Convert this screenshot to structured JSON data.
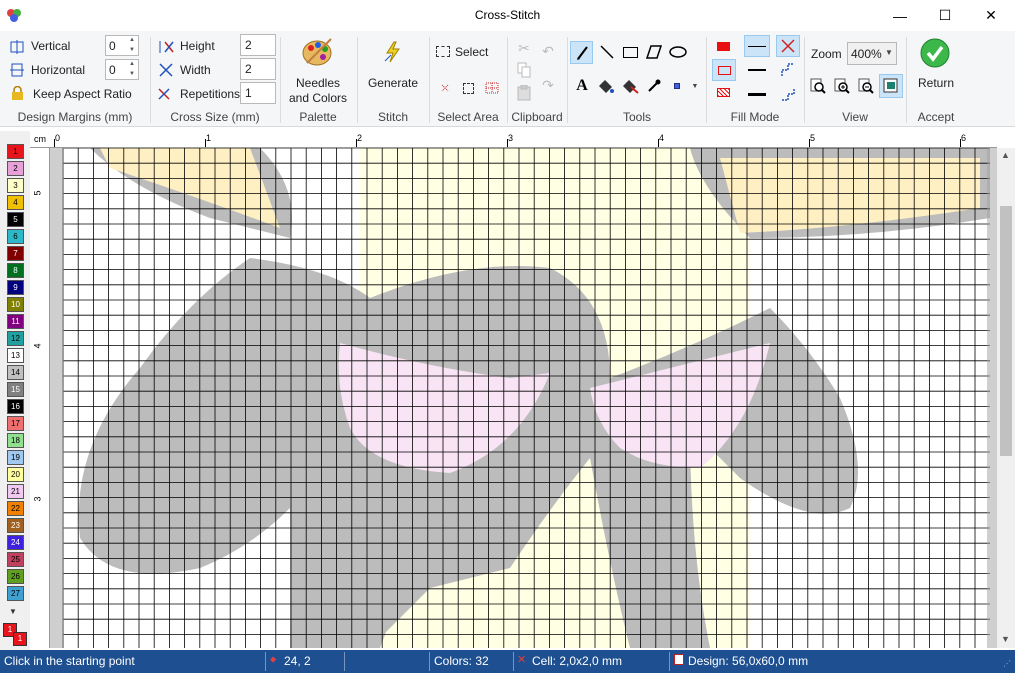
{
  "window": {
    "title": "Cross-Stitch",
    "minimize": "—",
    "maximize": "☐",
    "close": "✕"
  },
  "ribbon": {
    "design_margins": {
      "label": "Design Margins (mm)",
      "vertical_label": "Vertical",
      "vertical_value": "0",
      "horizontal_label": "Horizontal",
      "horizontal_value": "0",
      "keep_aspect_label": "Keep Aspect Ratio"
    },
    "cross_size": {
      "label": "Cross Size (mm)",
      "height_label": "Height",
      "height_value": "2",
      "width_label": "Width",
      "width_value": "2",
      "repetitions_label": "Repetitions",
      "repetitions_value": "1"
    },
    "palette": {
      "label": "Palette",
      "button_line1": "Needles",
      "button_line2": "and Colors"
    },
    "stitch": {
      "label": "Stitch",
      "button": "Generate"
    },
    "select_area": {
      "label": "Select Area",
      "select_button": "Select"
    },
    "clipboard": {
      "label": "Clipboard"
    },
    "tools": {
      "label": "Tools"
    },
    "fill_mode": {
      "label": "Fill Mode"
    },
    "view": {
      "label": "View",
      "zoom_label": "Zoom",
      "zoom_value": "400%"
    },
    "accept": {
      "label": "Accept",
      "button": "Return"
    }
  },
  "palette_colors": [
    {
      "n": "1",
      "c": "#e8141c"
    },
    {
      "n": "2",
      "c": "#e8a0d8"
    },
    {
      "n": "3",
      "c": "#ffffc8"
    },
    {
      "n": "4",
      "c": "#f0c000"
    },
    {
      "n": "5",
      "c": "#000000"
    },
    {
      "n": "6",
      "c": "#2cb8c8"
    },
    {
      "n": "7",
      "c": "#800000"
    },
    {
      "n": "8",
      "c": "#007020"
    },
    {
      "n": "9",
      "c": "#000080"
    },
    {
      "n": "10",
      "c": "#808000"
    },
    {
      "n": "11",
      "c": "#800080"
    },
    {
      "n": "12",
      "c": "#20a0a0"
    },
    {
      "n": "13",
      "c": "#ffffff"
    },
    {
      "n": "14",
      "c": "#c0c0c0"
    },
    {
      "n": "15",
      "c": "#808080"
    },
    {
      "n": "16",
      "c": "#000000"
    },
    {
      "n": "17",
      "c": "#f07070"
    },
    {
      "n": "18",
      "c": "#90e090"
    },
    {
      "n": "19",
      "c": "#a0c8f0"
    },
    {
      "n": "20",
      "c": "#ffffa0"
    },
    {
      "n": "21",
      "c": "#f0c8f0"
    },
    {
      "n": "22",
      "c": "#f08000"
    },
    {
      "n": "23",
      "c": "#a06020"
    },
    {
      "n": "24",
      "c": "#4020e0"
    },
    {
      "n": "25",
      "c": "#c04060"
    },
    {
      "n": "26",
      "c": "#60a020"
    },
    {
      "n": "27",
      "c": "#40a0d0"
    }
  ],
  "ruler": {
    "unit": "cm",
    "top_marks": [
      "0",
      "1",
      "2",
      "3",
      "4",
      "5",
      "6"
    ],
    "left_marks": [
      "5",
      "4",
      "3"
    ]
  },
  "canvas": {
    "grid_color": "#000000",
    "fill_colors": {
      "gray": "#bcbcbc",
      "cream": "#ffffe4",
      "tan": "#fff0c4",
      "pink": "#f8e4f4"
    }
  },
  "status": {
    "hint": "Click in the starting point",
    "coords": "24, 2",
    "colors": "Colors: 32",
    "cell": "Cell: 2,0x2,0 mm",
    "design": "Design: 56,0x60,0 mm"
  },
  "accent_colors": {
    "status_bar": "#1e4f91",
    "selected_tool": "#cce4f7",
    "accept_green": "#3cb84a"
  }
}
